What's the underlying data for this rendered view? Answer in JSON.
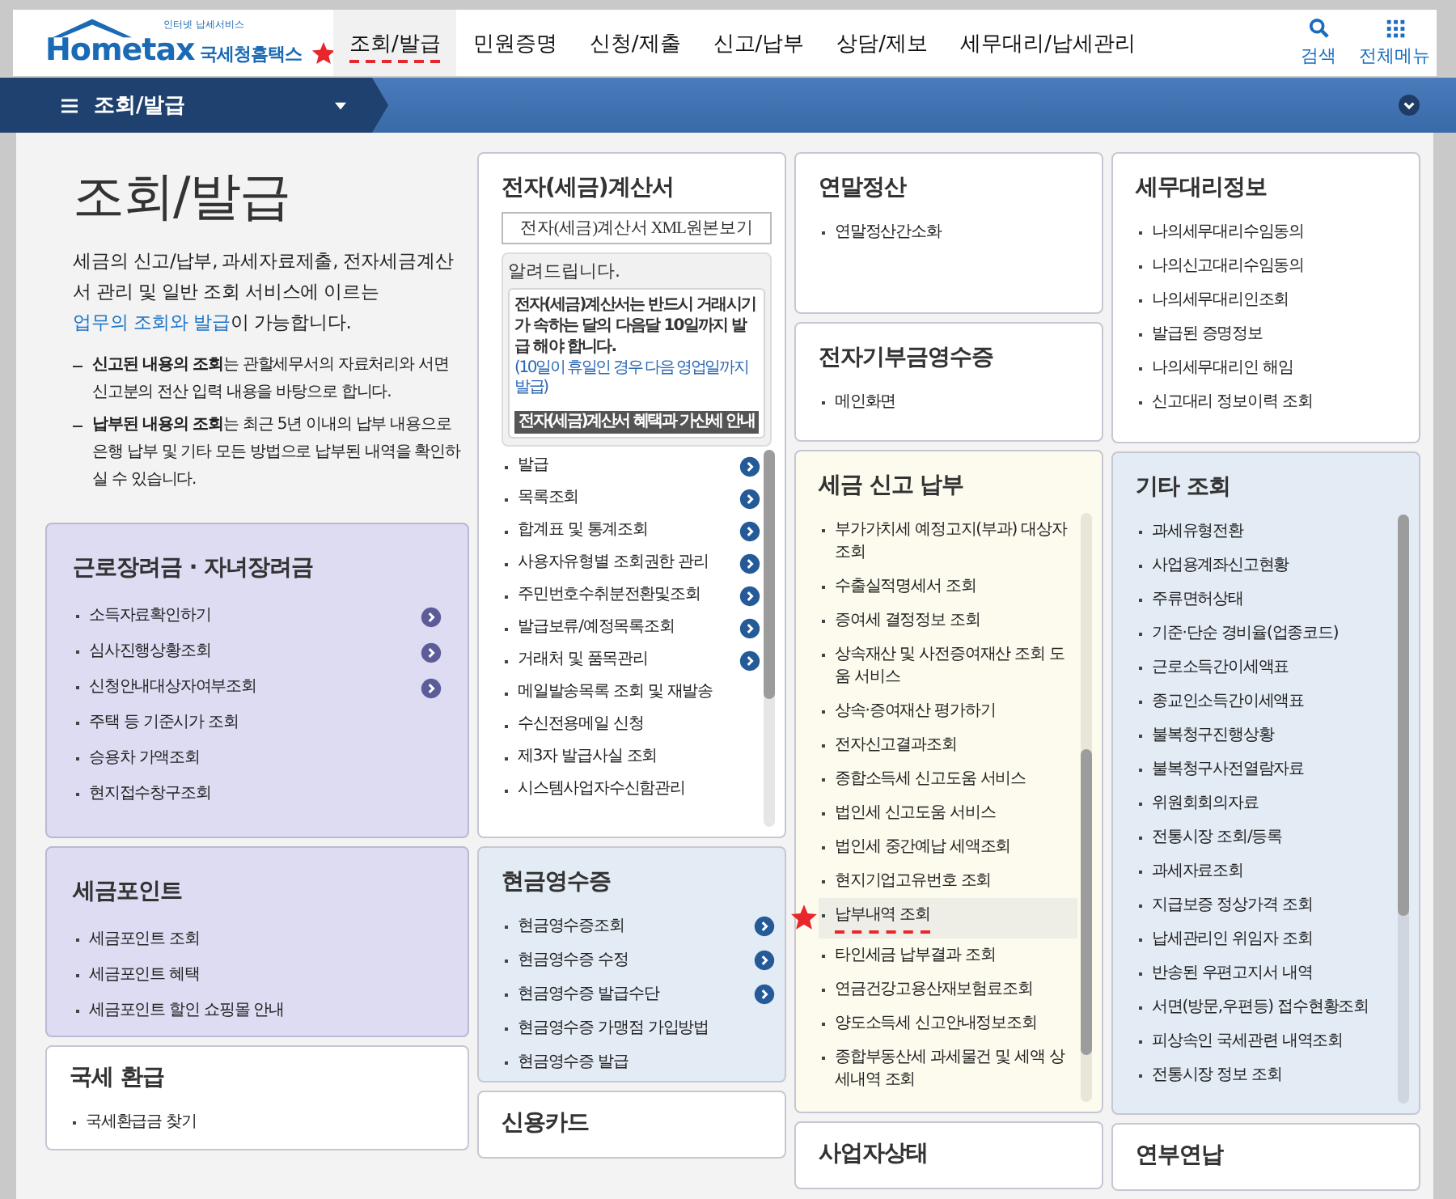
{
  "header": {
    "logo": {
      "tagline": "인터넷 납세서비스",
      "wordmark": "Hometax",
      "subtitle": "국세청홈택스"
    },
    "nav": [
      {
        "label": "조회/발급",
        "selected": true,
        "marked": true
      },
      {
        "label": "민원증명",
        "selected": false,
        "marked": false
      },
      {
        "label": "신청/제출",
        "selected": false,
        "marked": false
      },
      {
        "label": "신고/납부",
        "selected": false,
        "marked": false
      },
      {
        "label": "상담/제보",
        "selected": false,
        "marked": false
      },
      {
        "label": "세무대리/납세관리",
        "selected": false,
        "marked": false
      }
    ],
    "tools": [
      {
        "label": "검색",
        "kind": "search"
      },
      {
        "label": "전체메뉴",
        "kind": "grid"
      }
    ]
  },
  "breadcrumb": {
    "label": "조회/발급"
  },
  "intro": {
    "title": "조회/발급",
    "lead_before": "세금의 신고/납부, 과세자료제출, 전자세금계산서 관리 및 일반 조회 서비스에 이르는 ",
    "lead_link": "업무의 조회와 발급",
    "lead_after": "이 가능합니다.",
    "notes": [
      "**신고된 내용의 조회**는 관할세무서의 자료처리와 서면신고분의 전산 입력 내용을 바탕으로 합니다.",
      "**납부된 내용의 조회**는 최근 5년 이내의 납부 내용으로 은행 납부 및 기타 모든 방법으로 납부된 내역을 확인하실 수 있습니다."
    ]
  },
  "left_cards": [
    {
      "title": "근로장려금 · 자녀장려금",
      "color": "#dddcf2",
      "items": [
        {
          "label": "소득자료확인하기",
          "arrow": true
        },
        {
          "label": "심사진행상황조회",
          "arrow": true
        },
        {
          "label": "신청안내대상자여부조회",
          "arrow": true
        },
        {
          "label": "주택 등 기준시가 조회",
          "arrow": false
        },
        {
          "label": "승용차 가액조회",
          "arrow": false
        },
        {
          "label": "현지접수창구조회",
          "arrow": false
        }
      ]
    },
    {
      "title": "세금포인트",
      "color": "#dddcf2",
      "items": [
        {
          "label": "세금포인트 조회"
        },
        {
          "label": "세금포인트 혜택"
        },
        {
          "label": "세금포인트 할인 쇼핑몰 안내"
        }
      ]
    },
    {
      "title": "국세 환급",
      "color": "#ffffff",
      "items": [
        {
          "label": "국세환급금 찾기"
        }
      ]
    }
  ],
  "columns": [
    {
      "cards": [
        {
          "title": "전자(세금)계산서",
          "color": "#ffffff",
          "xml_button": "전자(세금)계산서 XML원본보기",
          "notice": {
            "heading": "알려드립니다.",
            "message": "**전자(세금)계산서**는 반드시 거래시기가 **속하는 달의 다음달 10일까지 발급** 해야 합니다.",
            "note": "(10일이 휴일인 경우 다음 영업일까지 발급)",
            "button": "전자(세금)계산서 혜택과 가산세 안내"
          },
          "scrollable": true,
          "items": [
            {
              "label": "발급",
              "arrow": true
            },
            {
              "label": "목록조회",
              "arrow": true
            },
            {
              "label": "합계표 및 통계조회",
              "arrow": true
            },
            {
              "label": "사용자유형별 조회권한 관리",
              "arrow": true
            },
            {
              "label": "주민번호수취분전환및조회",
              "arrow": true
            },
            {
              "label": "발급보류/예정목록조회",
              "arrow": true
            },
            {
              "label": "거래처 및 품목관리",
              "arrow": true
            },
            {
              "label": "메일발송목록 조회 및 재발송",
              "arrow": false
            },
            {
              "label": "수신전용메일 신청",
              "arrow": false
            },
            {
              "label": "제3자 발급사실 조회",
              "arrow": false
            },
            {
              "label": "시스템사업자수신함관리",
              "arrow": false
            }
          ]
        },
        {
          "title": "현금영수증",
          "color": "#e3ebf4",
          "items": [
            {
              "label": "현금영수증조회",
              "arrow": true
            },
            {
              "label": "현금영수증 수정",
              "arrow": true
            },
            {
              "label": "현금영수증 발급수단",
              "arrow": true
            },
            {
              "label": "현금영수증 가맹점 가입방법",
              "arrow": false
            },
            {
              "label": "현금영수증 발급",
              "arrow": false
            }
          ]
        },
        {
          "title": "신용카드",
          "color": "#ffffff"
        }
      ]
    },
    {
      "cards": [
        {
          "title": "연말정산",
          "color": "#ffffff",
          "items": [
            {
              "label": "연말정산간소화"
            }
          ]
        },
        {
          "title": "전자기부금영수증",
          "color": "#ffffff",
          "items": [
            {
              "label": "메인화면"
            }
          ]
        },
        {
          "title": "세금 신고 납부",
          "color": "#fdfbee",
          "scrollable": true,
          "items": [
            {
              "label": "부가가치세 예정고지(부과) 대상자 조회",
              "marked": false
            },
            {
              "label": "수출실적명세서 조회",
              "marked": false
            },
            {
              "label": "증여세 결정정보 조회",
              "marked": false
            },
            {
              "label": "상속재산 및 사전증여재산 조회 도움 서비스",
              "marked": false
            },
            {
              "label": "상속·증여재산 평가하기",
              "marked": false
            },
            {
              "label": "전자신고결과조회",
              "marked": false
            },
            {
              "label": "종합소득세 신고도움 서비스",
              "marked": false
            },
            {
              "label": "법인세 신고도움 서비스",
              "marked": false
            },
            {
              "label": "법인세 중간예납 세액조회",
              "marked": false
            },
            {
              "label": "현지기업고유번호 조회",
              "marked": false
            },
            {
              "label": "납부내역 조회",
              "marked": true
            },
            {
              "label": "타인세금 납부결과 조회",
              "marked": false
            },
            {
              "label": "연금건강고용산재보험료조회",
              "marked": false
            },
            {
              "label": "양도소득세 신고안내정보조회",
              "marked": false
            },
            {
              "label": "종합부동산세 과세물건 및 세액 상세내역 조회",
              "marked": false
            }
          ]
        },
        {
          "title": "사업자상태",
          "color": "#ffffff"
        }
      ]
    },
    {
      "cards": [
        {
          "title": "세무대리정보",
          "color": "#ffffff",
          "items": [
            {
              "label": "나의세무대리수임동의"
            },
            {
              "label": "나의신고대리수임동의"
            },
            {
              "label": "나의세무대리인조회"
            },
            {
              "label": "발급된 증명정보"
            },
            {
              "label": "나의세무대리인 해임"
            },
            {
              "label": "신고대리 정보이력 조회"
            }
          ]
        },
        {
          "title": "기타 조회",
          "color": "#e3ebf4",
          "scrollable": true,
          "items": [
            {
              "label": "과세유형전환"
            },
            {
              "label": "사업용계좌신고현황"
            },
            {
              "label": "주류면허상태"
            },
            {
              "label": "기준·단순 경비율(업종코드)"
            },
            {
              "label": "근로소득간이세액표"
            },
            {
              "label": "종교인소득간이세액표"
            },
            {
              "label": "불복청구진행상황"
            },
            {
              "label": "불복청구사전열람자료"
            },
            {
              "label": "위원회회의자료"
            },
            {
              "label": "전통시장 조회/등록"
            },
            {
              "label": "과세자료조회"
            },
            {
              "label": "지급보증 정상가격 조회"
            },
            {
              "label": "납세관리인 위임자 조회"
            },
            {
              "label": "반송된 우편고지서 내역"
            },
            {
              "label": "서면(방문,우편등) 접수현황조회"
            },
            {
              "label": "피상속인 국세관련 내역조회"
            },
            {
              "label": "전통시장 정보 조회"
            }
          ]
        },
        {
          "title": "연부연납",
          "color": "#ffffff"
        }
      ]
    }
  ]
}
